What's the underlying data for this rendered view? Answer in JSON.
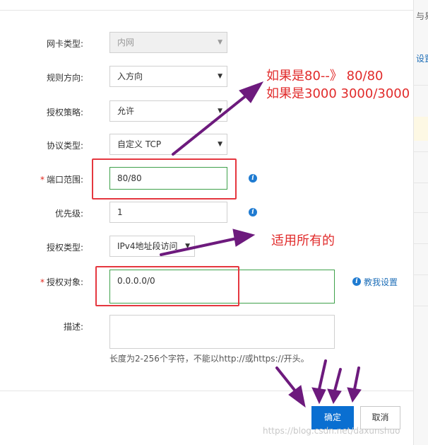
{
  "form": {
    "nic_type": {
      "label": "网卡类型:",
      "value": "内网"
    },
    "direction": {
      "label": "规则方向:",
      "value": "入方向"
    },
    "policy": {
      "label": "授权策略:",
      "value": "允许"
    },
    "protocol": {
      "label": "协议类型:",
      "value": "自定义 TCP"
    },
    "port_range": {
      "label": "端口范围:",
      "value": "80/80",
      "required_mark": "*"
    },
    "priority": {
      "label": "优先级:",
      "value": "1"
    },
    "auth_type": {
      "label": "授权类型:",
      "value": "IPv4地址段访问"
    },
    "auth_object": {
      "label": "授权对象:",
      "value": "0.0.0.0/0",
      "required_mark": "*",
      "help_link": "教我设置"
    },
    "description": {
      "label": "描述:",
      "value": "",
      "hint": "长度为2-256个字符，不能以http://或https://开头。"
    }
  },
  "buttons": {
    "confirm": "确定",
    "cancel": "取消"
  },
  "right_panel": {
    "text_1": "与易",
    "text_2": "设置"
  },
  "annotations": {
    "port_note_line1": "如果是80--》 80/80",
    "port_note_line2": "如果是3000 3000/3000",
    "auth_note": "适用所有的"
  },
  "watermark": "https://blog.csdn.net/daxunshuo",
  "colors": {
    "primary": "#0a6fd1",
    "valid_border": "#3fa14b",
    "annotation_red": "#e12b2b",
    "highlight_box": "#e5373f",
    "arrow_purple": "#6d1a7d",
    "info_icon": "#1f7bd1"
  }
}
